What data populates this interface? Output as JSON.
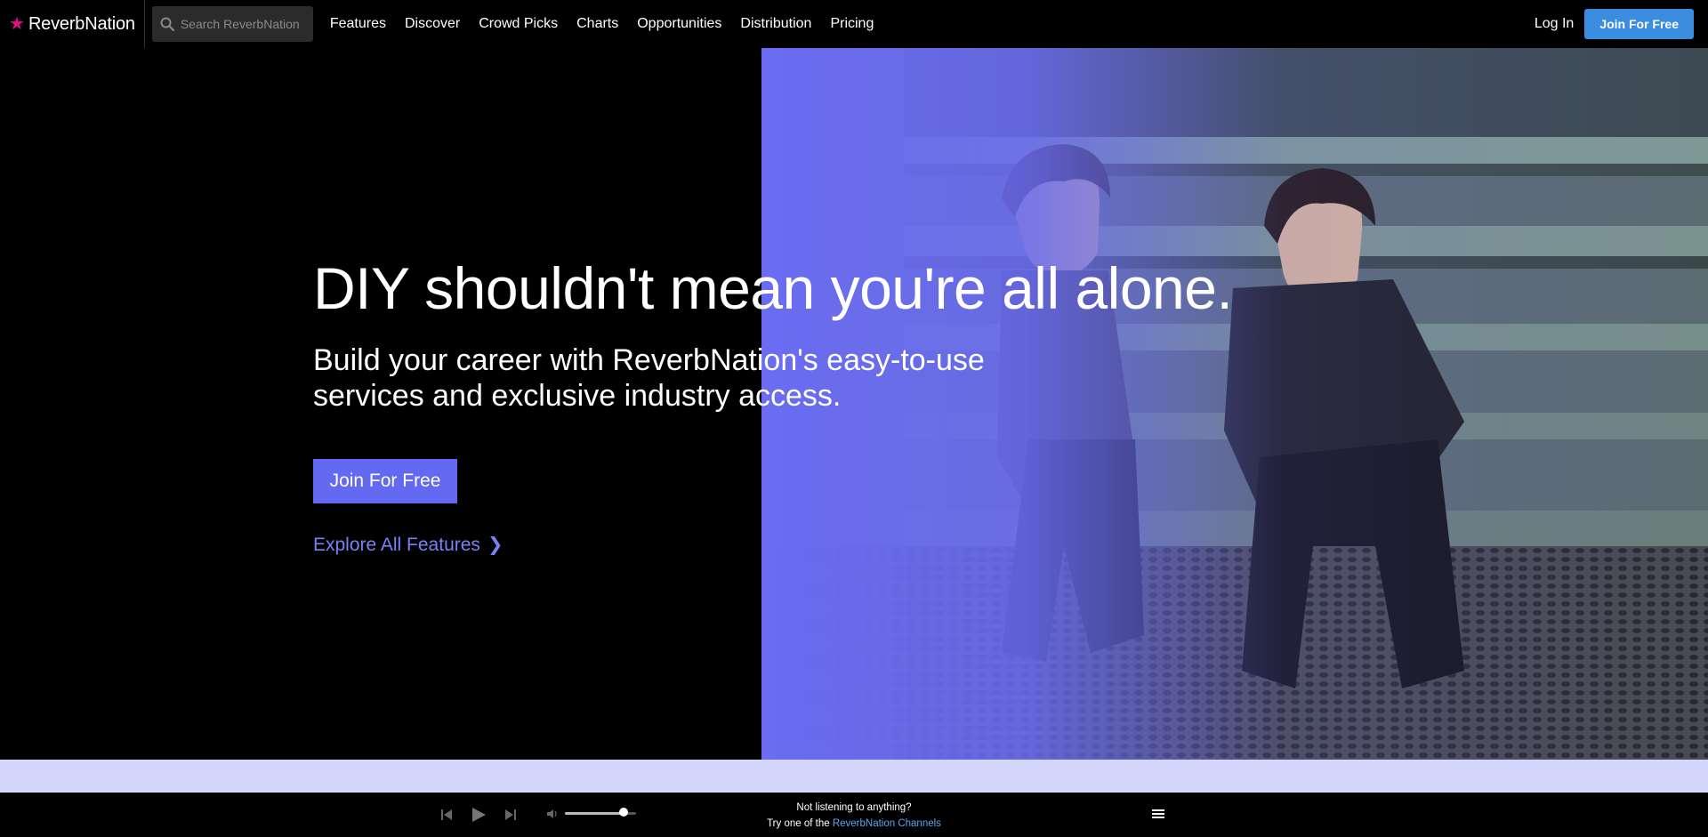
{
  "nav": {
    "logo_text": "ReverbNation",
    "search_placeholder": "Search ReverbNation",
    "links": [
      "Features",
      "Discover",
      "Crowd Picks",
      "Charts",
      "Opportunities",
      "Distribution",
      "Pricing"
    ],
    "login": "Log In",
    "join": "Join For Free"
  },
  "hero": {
    "headline": "DIY shouldn't mean you're all alone.",
    "subhead": "Build your career with ReverbNation's easy-to-use services and exclusive industry access.",
    "cta": "Join For Free",
    "explore": "Explore All Features",
    "explore_chevron": "❯"
  },
  "player": {
    "message_line1": "Not listening to anything?",
    "message_line2_prefix": "Try one of the ",
    "channels_link": "ReverbNation Channels",
    "volume_level": 0.82
  },
  "colors": {
    "accent": "#6369f0",
    "join_top": "#3b8de0",
    "logo_star": "#e0117f",
    "band": "#d4d6fc",
    "link_blue": "#5aa7f0"
  }
}
